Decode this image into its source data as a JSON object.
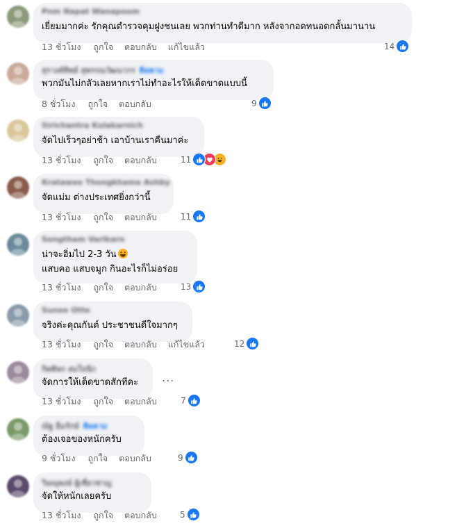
{
  "comments": [
    {
      "author": "Pnm Napat Wanapoom",
      "follow": "",
      "text": [
        "เยี่ยมมากค่ะ รักคุณตำรวจคุมฝูงชนเลย พวกท่านทำดีมาก หลังจากอดทนอดกลั้นมานาน"
      ],
      "time": "13 ชั่วโมง",
      "like": "ถูกใจ",
      "reply": "ตอบกลับ",
      "edited": "แก้ไขแล้ว",
      "count": "14",
      "reactions": [
        "like-icon"
      ],
      "avatar": "#8a9a7a"
    },
    {
      "author": "สุรางค์ทิพย์ สุพรรณวัฒนากร",
      "follow": "ติดตาม",
      "text": [
        "พวกมันไม่กลัวเลยหากเราไม่ทำอะไรให้เด็ดขาดแบบนี้"
      ],
      "time": "8 ชั่วโมง",
      "like": "ถูกใจ",
      "reply": "ตอบกลับ",
      "edited": "",
      "count": "9",
      "reactions": [
        "like-icon"
      ],
      "avatar": "#c9a99a"
    },
    {
      "author": "Sirichantra Kulakarnich",
      "follow": "",
      "text": [
        "จัดไปเร็วๆอย่าช้า เอาบ้านเราคืนมาค่ะ"
      ],
      "time": "13 ชั่วโมง",
      "like": "ถูกใจ",
      "reply": "ตอบกลับ",
      "edited": "",
      "count": "11",
      "reactions": [
        "like-icon",
        "love-icon",
        "haha-icon"
      ],
      "avatar": "#d9c79a"
    },
    {
      "author": "Kratawee Thongkhame Ashby",
      "follow": "",
      "text": [
        "จัดแม่ม ต่างประเทศยิ่งกว่านี้"
      ],
      "time": "13 ชั่วโมง",
      "like": "ถูกใจ",
      "reply": "ตอบกลับ",
      "edited": "",
      "count": "11",
      "reactions": [
        "like-icon"
      ],
      "avatar": "#8a5a4a"
    },
    {
      "author": "Songtham Varikarn",
      "follow": "",
      "text": [
        "น่าจะอิ่มไป 2-3 วัน",
        "แสบคอ แสบจมูก กินอะไรก็ไม่อร่อย"
      ],
      "time": "13 ชั่วโมง",
      "like": "ถูกใจ",
      "reply": "ตอบกลับ",
      "edited": "",
      "count": "13",
      "reactions": [
        "like-icon"
      ],
      "avatar": "#6a8a9a"
    },
    {
      "author": "Sunee Otte",
      "follow": "",
      "text": [
        "จริงค่ะคุณกันต์ ประชาชนดีใจมากๆ"
      ],
      "time": "13 ชั่วโมง",
      "like": "ถูกใจ",
      "reply": "ตอบกลับ",
      "edited": "แก้ไขแล้ว",
      "count": "12",
      "reactions": [
        "like-icon"
      ],
      "avatar": "#8a9aaa"
    },
    {
      "author": "กิตติพร สมใจนึก",
      "follow": "",
      "text": [
        "จัดการให้เด็ดขาดสักทีคะ"
      ],
      "time": "13 ชั่วโมง",
      "like": "ถูกใจ",
      "reply": "ตอบกลับ",
      "edited": "",
      "count": "7",
      "reactions": [
        "like-icon"
      ],
      "avatar": "#9a8a9a"
    },
    {
      "author": "ณัฐ อิ่มรักษ์",
      "follow": "ติดตาม",
      "text": [
        "ต้องเจอของหนักครับ"
      ],
      "time": "9 ชั่วโมง",
      "like": "ถูกใจ",
      "reply": "ตอบกลับ",
      "edited": "",
      "count": "9",
      "reactions": [
        "like-icon"
      ],
      "avatar": "#7a9a6a"
    },
    {
      "author": "วิษณุพงษ์ ผู้เชี่ยวชาญ",
      "follow": "",
      "text": [
        "จัดให้หนักเลยครับ"
      ],
      "time": "13 ชั่วโมง",
      "like": "ถูกใจ",
      "reply": "ตอบกลับ",
      "edited": "",
      "count": "5",
      "reactions": [
        "like-icon"
      ],
      "avatar": "#5a4a6a"
    }
  ],
  "more_options_label": "..."
}
